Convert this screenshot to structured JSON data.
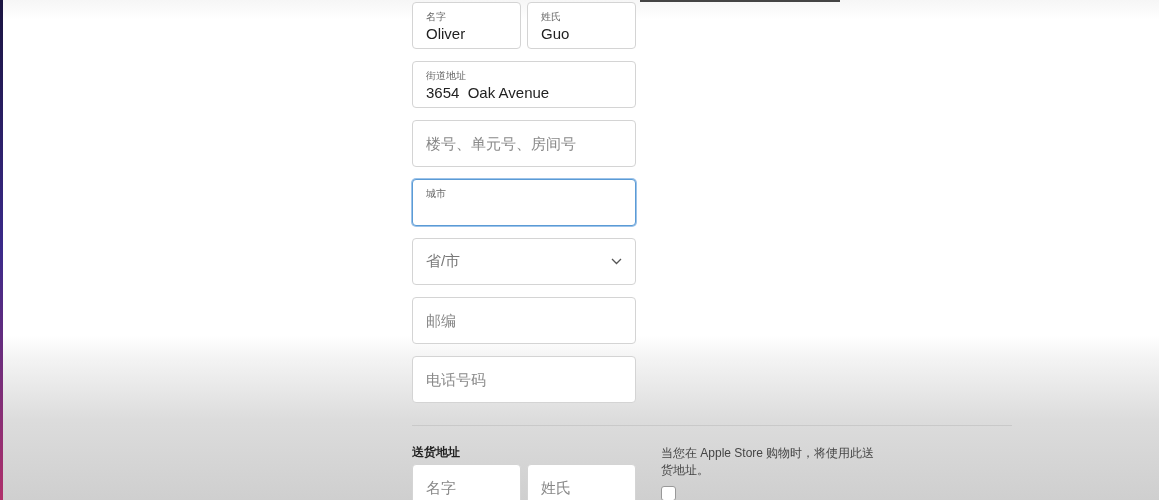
{
  "billing": {
    "name_row": [
      {
        "label": "名字",
        "value": "Oliver",
        "focused": false
      },
      {
        "label": "姓氏",
        "value": "Guo",
        "focused": false
      }
    ],
    "fields": [
      {
        "kind": "text",
        "label": "街道地址",
        "value": "3654  Oak Avenue",
        "focused": false
      },
      {
        "kind": "text",
        "placeholder": "楼号、单元号、房间号",
        "focused": false
      },
      {
        "kind": "text",
        "label": "城市",
        "focused": true
      },
      {
        "kind": "select",
        "placeholder": "省/市",
        "focused": false
      },
      {
        "kind": "text",
        "placeholder": "邮编",
        "focused": false
      },
      {
        "kind": "text",
        "placeholder": "电话号码",
        "focused": false
      }
    ]
  },
  "shipping": {
    "title": "送货地址",
    "note": "当您在 Apple Store 购物时，将使用此送货地址。",
    "checkbox": {
      "checked": false
    },
    "name_row": [
      {
        "placeholder": "名字",
        "focused": false
      },
      {
        "placeholder": "姓氏",
        "focused": false
      }
    ]
  }
}
